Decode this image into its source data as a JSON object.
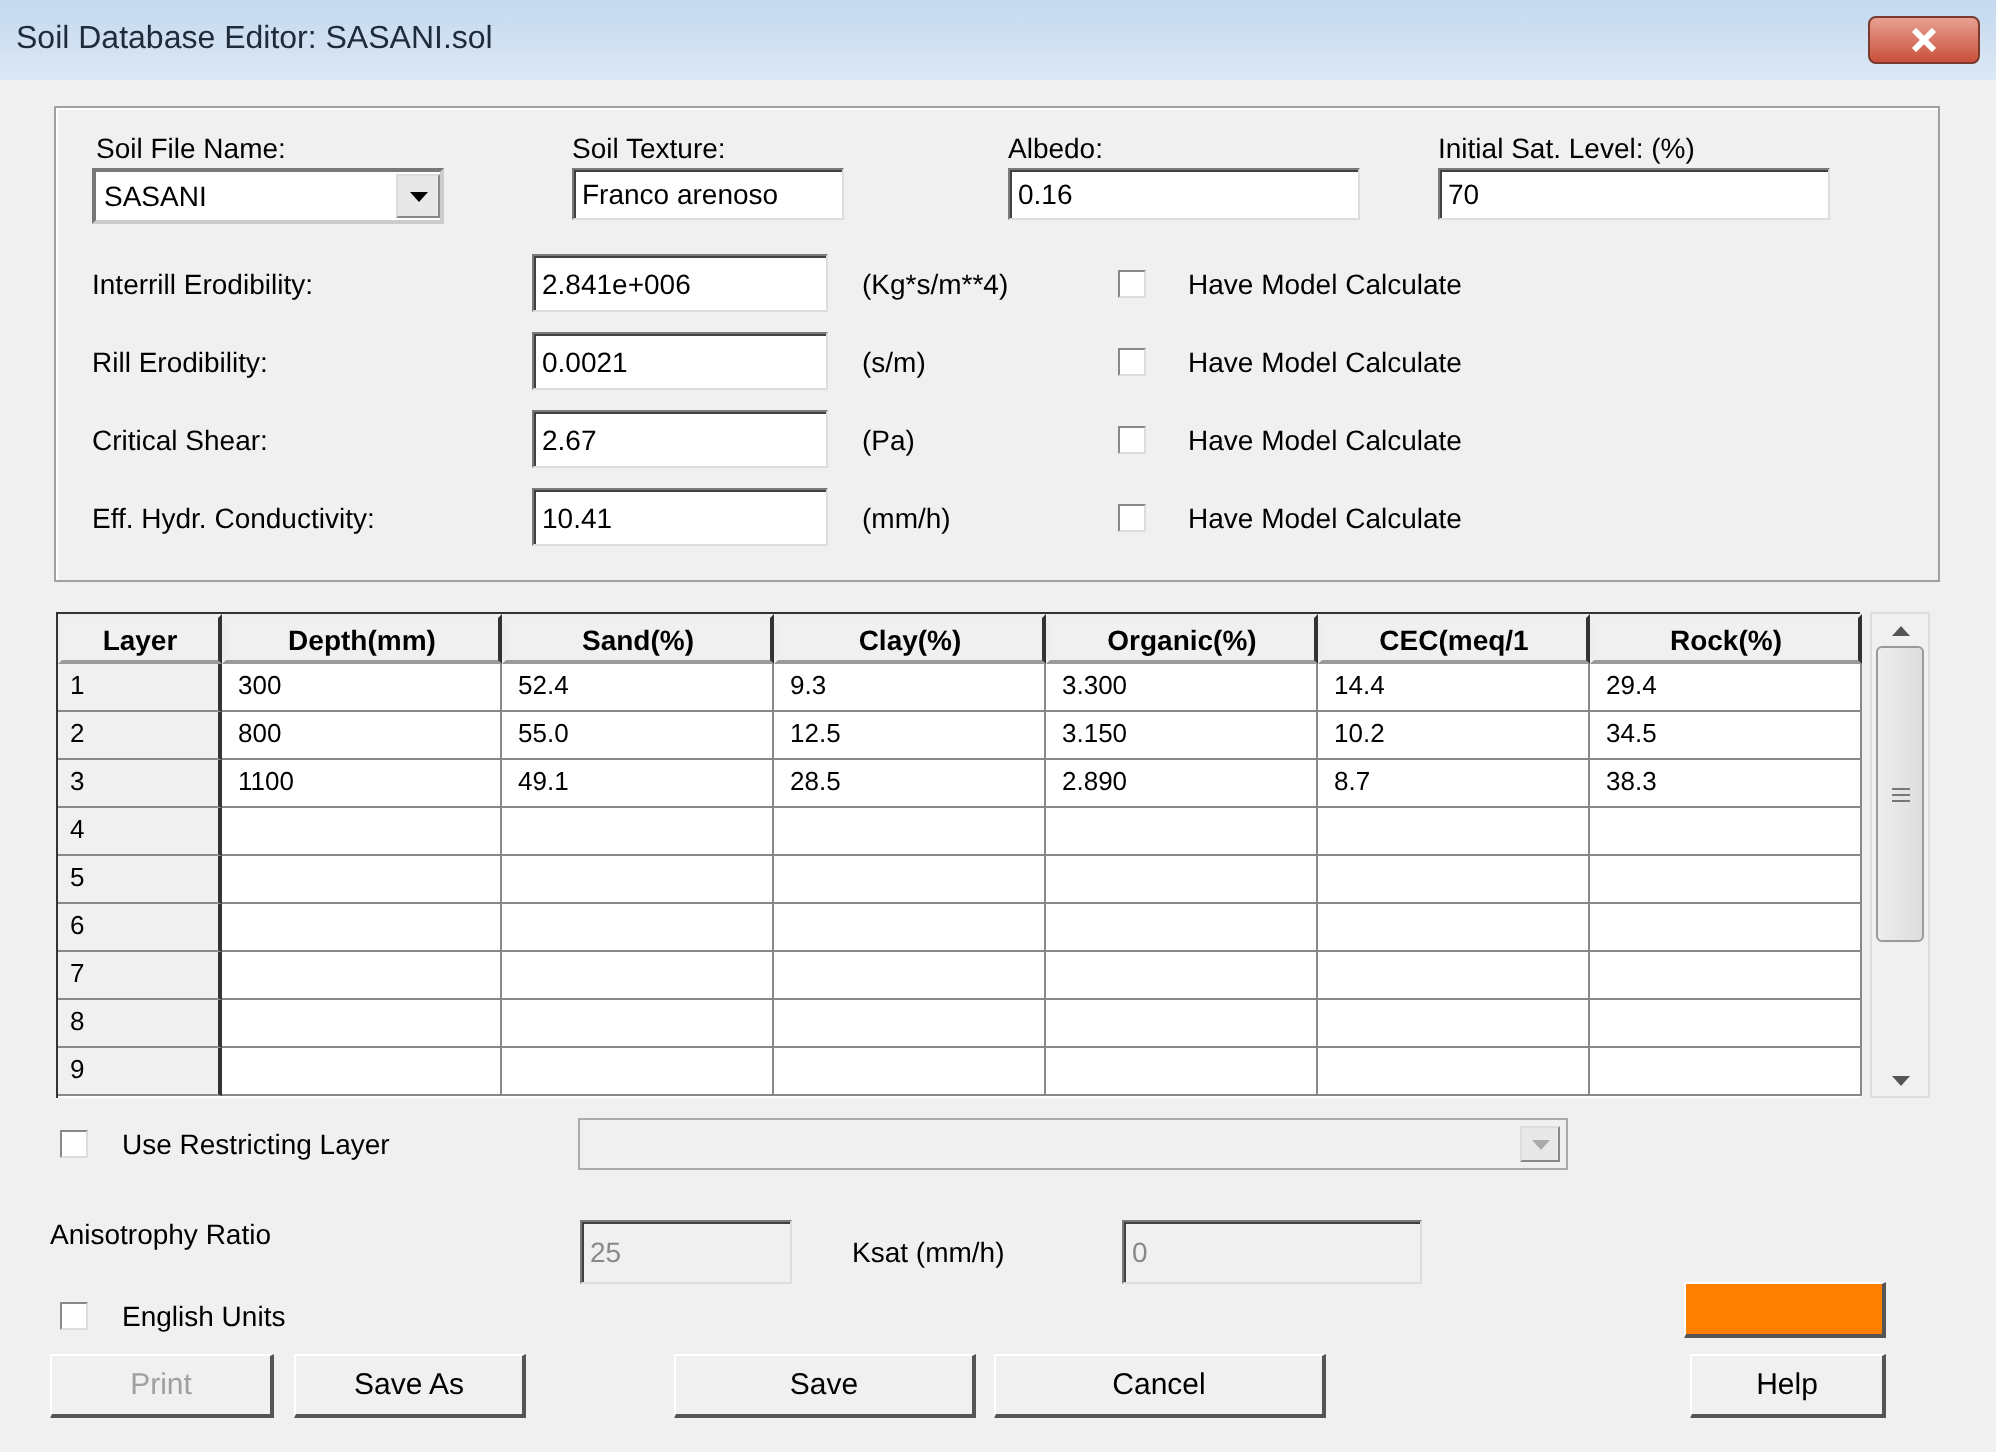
{
  "window": {
    "title": "Soil Database Editor: SASANI.sol"
  },
  "top_fields": [
    {
      "label": "Soil File Name:",
      "value": "SASANI",
      "kind": "combo"
    },
    {
      "label": "Soil Texture:",
      "value": "Franco arenoso",
      "kind": "text"
    },
    {
      "label": "Albedo:",
      "value": "0.16",
      "kind": "text"
    },
    {
      "label": "Initial Sat. Level:  (%)",
      "value": "70",
      "kind": "text"
    }
  ],
  "parameters": [
    {
      "label": "Interrill Erodibility:",
      "value": "2.841e+006",
      "unit": "(Kg*s/m**4)",
      "calc_label": "Have Model Calculate",
      "checked": false
    },
    {
      "label": "Rill Erodibility:",
      "value": "0.0021",
      "unit": "(s/m)",
      "calc_label": "Have Model Calculate",
      "checked": false
    },
    {
      "label": "Critical Shear:",
      "value": "2.67",
      "unit": "(Pa)",
      "calc_label": "Have Model Calculate",
      "checked": false
    },
    {
      "label": "Eff. Hydr. Conductivity:",
      "value": "10.41",
      "unit": "(mm/h)",
      "calc_label": "Have Model Calculate",
      "checked": false
    }
  ],
  "table": {
    "columns": [
      "Layer",
      "Depth(mm)",
      "Sand(%)",
      "Clay(%)",
      "Organic(%)",
      "CEC(meq/1",
      "Rock(%)"
    ],
    "rows": [
      {
        "layer": "1",
        "values": [
          "300",
          "52.4",
          "9.3",
          "3.300",
          "14.4",
          "29.4"
        ]
      },
      {
        "layer": "2",
        "values": [
          "800",
          "55.0",
          "12.5",
          "3.150",
          "10.2",
          "34.5"
        ]
      },
      {
        "layer": "3",
        "values": [
          "1100",
          "49.1",
          "28.5",
          "2.890",
          "8.7",
          "38.3"
        ]
      },
      {
        "layer": "4"
      },
      {
        "layer": "5"
      },
      {
        "layer": "6"
      },
      {
        "layer": "7"
      },
      {
        "layer": "8"
      },
      {
        "layer": "9"
      }
    ]
  },
  "restricting_layer": {
    "label": "Use Restricting Layer",
    "checked": false,
    "disabled": true
  },
  "anisotropy": {
    "label": "Anisotrophy Ratio",
    "value": "25",
    "disabled": true
  },
  "ksat": {
    "label": "Ksat (mm/h)",
    "value": "0",
    "disabled": true
  },
  "english_units": {
    "label": "English Units",
    "checked": false
  },
  "color_button": {
    "color": "#ff8000"
  },
  "buttons": {
    "left": [
      {
        "label": "Print",
        "disabled": true
      },
      {
        "label": "Save As",
        "disabled": false
      }
    ],
    "middle": [
      {
        "label": "Save",
        "disabled": false
      },
      {
        "label": "Cancel",
        "disabled": false
      }
    ],
    "right": [
      {
        "label": "Help",
        "disabled": false
      }
    ]
  }
}
